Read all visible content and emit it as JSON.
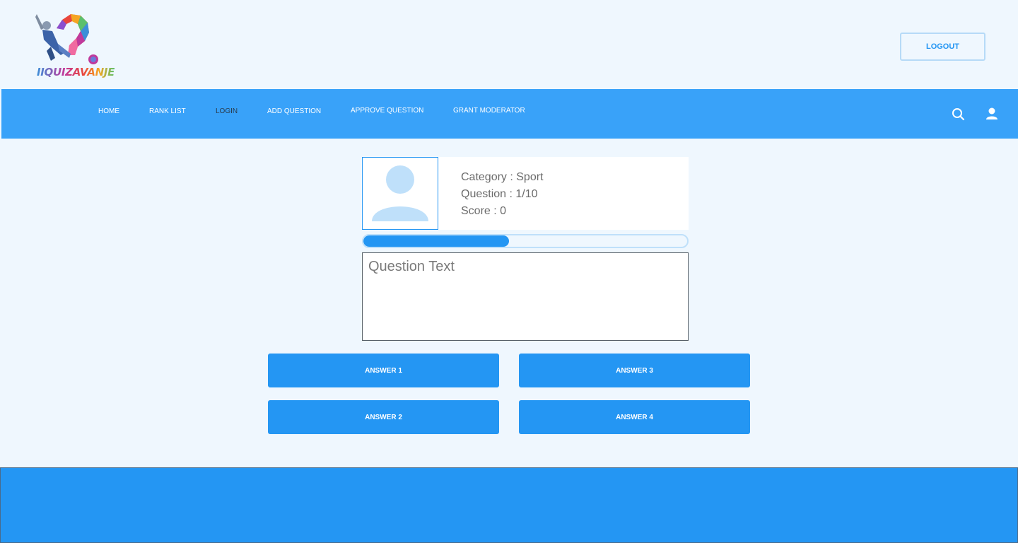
{
  "brand": {
    "logo_text": "IIQUIZAVANJE"
  },
  "header": {
    "logout_label": "LOGOUT"
  },
  "nav": {
    "items": [
      {
        "label": "HOME"
      },
      {
        "label": "RANK LIST"
      },
      {
        "label": "LOGIN"
      },
      {
        "label": "ADD QUESTION"
      },
      {
        "label": "APPROVE QUESTION"
      },
      {
        "label": "GRANT MODERATOR"
      }
    ],
    "icons": [
      "search-icon",
      "user-icon"
    ]
  },
  "quiz": {
    "category_line": "Category : Sport",
    "question_line": "Question : 1/10",
    "score_line": "Score : 0",
    "progress_fraction": 0.45,
    "question_text": "Question Text",
    "answers": [
      {
        "label": "ANSWER 1"
      },
      {
        "label": "ANSWER 2"
      },
      {
        "label": "ANSWER 3"
      },
      {
        "label": "ANSWER 4"
      }
    ]
  },
  "colors": {
    "nav_bg": "#39a2f9",
    "accent": "#2496f3",
    "page_bg": "#eff7fe"
  }
}
